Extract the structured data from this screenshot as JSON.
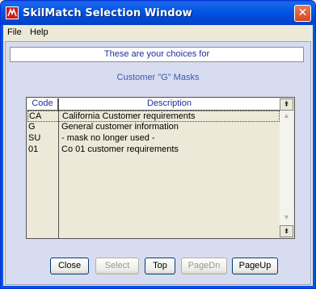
{
  "window": {
    "title": "SkilMatch Selection Window",
    "close_glyph": "✕"
  },
  "menu": {
    "items": [
      "File",
      "Help"
    ]
  },
  "header": {
    "choices_text": "These are your choices for",
    "subtitle": "Customer \"G\" Masks"
  },
  "table": {
    "columns": [
      "Code",
      "Description"
    ],
    "rows": [
      {
        "code": "CA",
        "description": "California Customer requirements"
      },
      {
        "code": "G",
        "description": "General customer information"
      },
      {
        "code": "SU",
        "description": "- mask no longer used -"
      },
      {
        "code": "01",
        "description": "Co 01 customer requirements"
      }
    ],
    "scroll_top_glyph": "⇞",
    "scroll_bottom_glyph": "⇟",
    "scroll_up_glyph": "▲",
    "scroll_down_glyph": "▼"
  },
  "buttons": {
    "close": "Close",
    "select": "Select",
    "top": "Top",
    "pagedn": "PageDn",
    "pageup": "PageUp"
  },
  "colors": {
    "titlebar": "#0054e3",
    "panel": "#d8dcf0",
    "heading_text": "#1e2f9b"
  }
}
